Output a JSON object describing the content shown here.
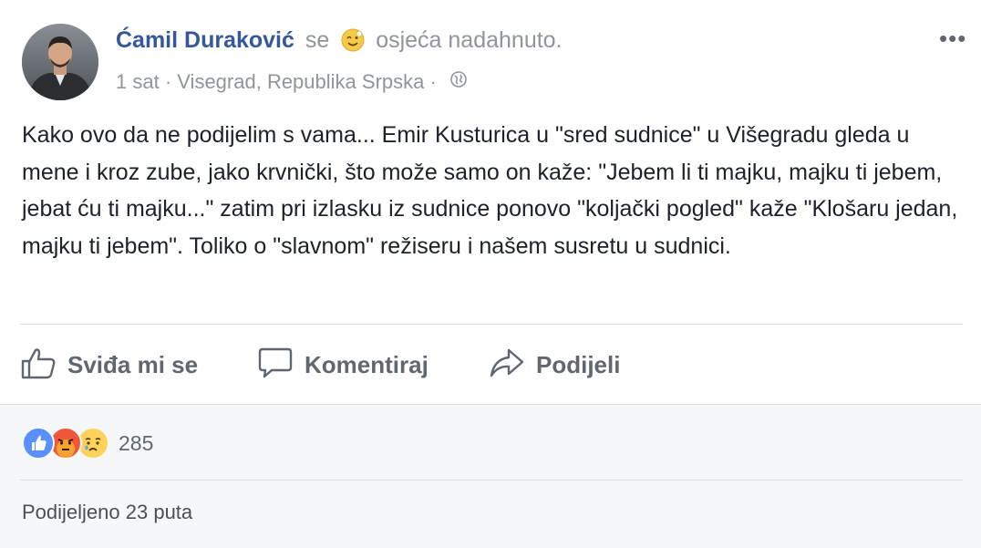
{
  "post": {
    "author_name": "Ćamil Duraković",
    "feeling_prefix": "se",
    "feeling_icon": "smiling-emoji-icon",
    "feeling_text": "osjeća nadahnuto.",
    "time": "1 sat",
    "separator": "·",
    "location": "Visegrad, Republika Srpska",
    "privacy_icon": "globe-icon",
    "more_icon": "•••",
    "text": "Kako ovo da ne podijelim s vama... Emir Kusturica u \"sred sudnice\" u Višegradu gleda u mene i kroz zube, jako krvnički, što može samo on kaže: \"Jebem li ti majku, majku ti jebem, jebat ću ti majku...\" zatim pri izlasku iz sudnice ponovo \"koljački pogled\" kaže \"Klošaru jedan, majku ti jebem\". Toliko o \"slavnom\" režiseru i našem susretu u sudnici."
  },
  "actions": {
    "like_label": "Sviđa mi se",
    "comment_label": "Komentiraj",
    "share_label": "Podijeli"
  },
  "reactions": {
    "icons": [
      "like-reaction-icon",
      "angry-reaction-icon",
      "sad-reaction-icon"
    ],
    "count": "285"
  },
  "shares": {
    "text": "Podijeljeno 23 puta"
  },
  "colors": {
    "author": "#365899",
    "meta": "#90949c",
    "action": "#606770",
    "like_blue": "#5890ff",
    "angry_orange": "#f0573b",
    "sad_yellow": "#fcd35a"
  }
}
